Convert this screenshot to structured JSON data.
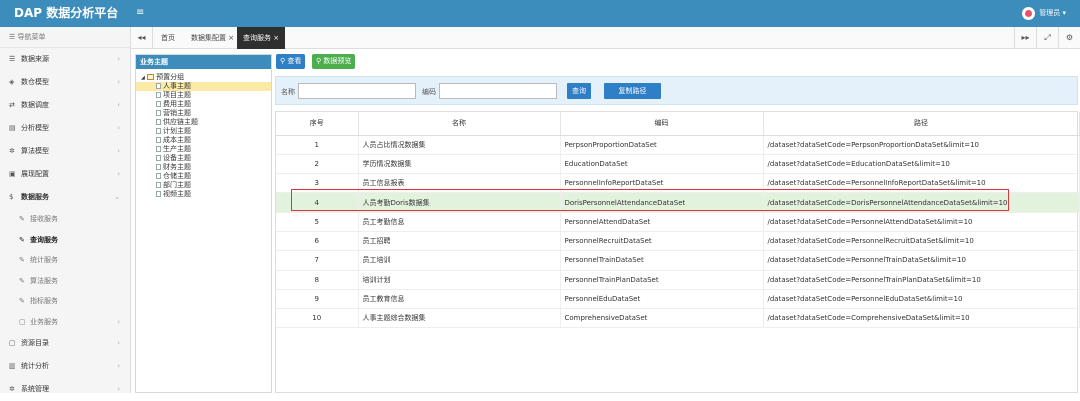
{
  "app": {
    "title": "DAP 数据分析平台",
    "menu_toggle": "≡",
    "user_name": "管理员",
    "user_caret": "▾"
  },
  "sidebar": {
    "header": "导航菜单",
    "items": [
      {
        "label": "数据来源",
        "icon": "database-icon",
        "glyph": "☰"
      },
      {
        "label": "数仓模型",
        "icon": "cubes-icon",
        "glyph": "◈"
      },
      {
        "label": "数据调度",
        "icon": "shuffle-icon",
        "glyph": "⇄"
      },
      {
        "label": "分析模型",
        "icon": "chart-icon",
        "glyph": "▤"
      },
      {
        "label": "算法模型",
        "icon": "gear-icon",
        "glyph": "✲"
      },
      {
        "label": "展现配置",
        "icon": "window-icon",
        "glyph": "▣"
      },
      {
        "label": "数据服务",
        "icon": "dollar-icon",
        "glyph": "$"
      }
    ],
    "subitems": [
      {
        "label": "接收服务",
        "active": false
      },
      {
        "label": "查询服务",
        "active": true
      },
      {
        "label": "统计服务",
        "active": false
      },
      {
        "label": "算法服务",
        "active": false
      },
      {
        "label": "指标服务",
        "active": false
      },
      {
        "label": "业务服务",
        "active": false
      }
    ],
    "bottom_items": [
      {
        "label": "资源目录",
        "icon": "folder-icon",
        "glyph": "▢"
      },
      {
        "label": "统计分析",
        "icon": "chart-icon",
        "glyph": "▥"
      },
      {
        "label": "系统管理",
        "icon": "gear-icon",
        "glyph": "✲"
      }
    ]
  },
  "tabs": {
    "back": "◂◂",
    "items": [
      {
        "label": "首页",
        "closable": false
      },
      {
        "label": "数据集配置",
        "closable": true
      },
      {
        "label": "查询服务",
        "closable": true
      }
    ],
    "close": "×",
    "tools": {
      "forward": "▸▸",
      "fullscreen": "⤢",
      "settings": "⚙"
    }
  },
  "tree": {
    "header": "业务主题",
    "root_toggle": "◢",
    "root": "预置分组",
    "nodes": [
      "人事主题",
      "项目主题",
      "费用主题",
      "营销主题",
      "供应链主题",
      "计划主题",
      "成本主题",
      "生产主题",
      "设备主题",
      "财务主题",
      "仓储主题",
      "部门主题",
      "视频主题"
    ],
    "selected_index": 0
  },
  "toolbar": {
    "view_label": "查看",
    "preview_label": "数据预览",
    "view_color": "#2f7fc7",
    "preview_color": "#4cae4c"
  },
  "search": {
    "name_label": "名称",
    "name_value": "",
    "code_label": "编码",
    "code_value": "",
    "query_button": "查询",
    "copy_button": "复制路径"
  },
  "table": {
    "columns": [
      "序号",
      "名称",
      "编码",
      "路径"
    ],
    "rows": [
      {
        "idx": "1",
        "name": "人员占比情况数据集",
        "code": "PerpsonProportionDataSet",
        "path": "/dataset?dataSetCode=PerpsonProportionDataSet&limit=10"
      },
      {
        "idx": "2",
        "name": "学历情况数据集",
        "code": "EducationDataSet",
        "path": "/dataset?dataSetCode=EducationDataSet&limit=10"
      },
      {
        "idx": "3",
        "name": "员工信息报表",
        "code": "PersonnelInfoReportDataSet",
        "path": "/dataset?dataSetCode=PersonnelInfoReportDataSet&limit=10"
      },
      {
        "idx": "4",
        "name": "人员考勤Doris数据集",
        "code": "DorisPersonnelAttendanceDataSet",
        "path": "/dataset?dataSetCode=DorisPersonnelAttendanceDataSet&limit=10"
      },
      {
        "idx": "5",
        "name": "员工考勤信息",
        "code": "PersonnelAttendDataSet",
        "path": "/dataset?dataSetCode=PersonnelAttendDataSet&limit=10"
      },
      {
        "idx": "6",
        "name": "员工招聘",
        "code": "PersonnelRecruitDataSet",
        "path": "/dataset?dataSetCode=PersonnelRecruitDataSet&limit=10"
      },
      {
        "idx": "7",
        "name": "员工培训",
        "code": "PersonnelTrainDataSet",
        "path": "/dataset?dataSetCode=PersonnelTrainDataSet&limit=10"
      },
      {
        "idx": "8",
        "name": "培训计划",
        "code": "PersonnelTrainPlanDataSet",
        "path": "/dataset?dataSetCode=PersonnelTrainPlanDataSet&limit=10"
      },
      {
        "idx": "9",
        "name": "员工教育信息",
        "code": "PersonnelEduDataSet",
        "path": "/dataset?dataSetCode=PersonnelEduDataSet&limit=10"
      },
      {
        "idx": "10",
        "name": "人事主题综合数据集",
        "code": "ComprehensiveDataSet",
        "path": "/dataset?dataSetCode=ComprehensiveDataSet&limit=10"
      }
    ],
    "highlighted_row": 3,
    "highlight_color": "#e3f2dd",
    "annotation_color": "#d9363e"
  },
  "colors": {
    "header": "#3c8dbc",
    "active_tab": "#2f2f2f",
    "search_bg": "#e4f1fa"
  }
}
